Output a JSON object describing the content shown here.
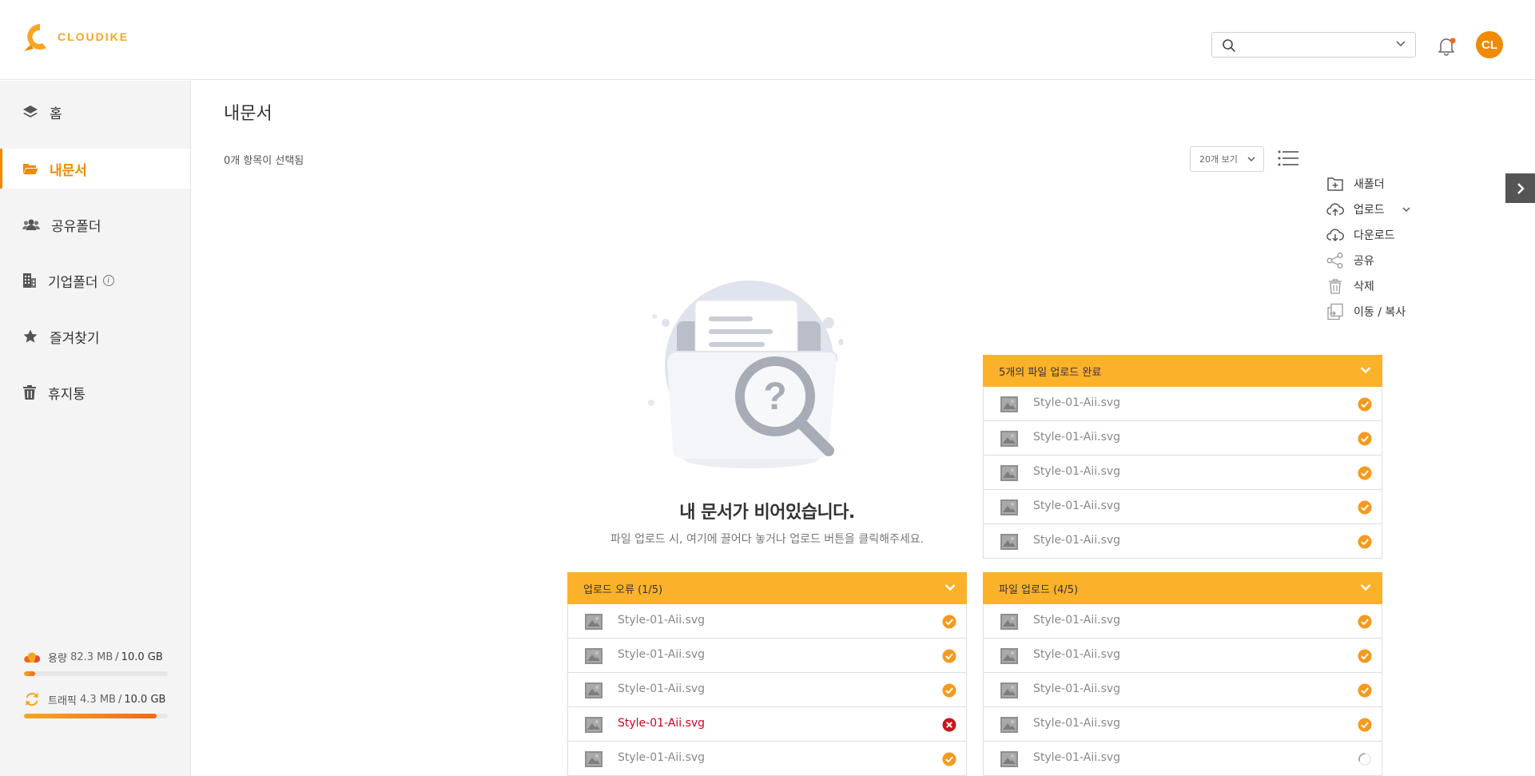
{
  "header": {
    "brand": "CLOUDIKE",
    "avatar_initials": "CL",
    "colors": {
      "brand": "#f5a623",
      "avatar": "#f08a00"
    },
    "icons": [
      "cloudike-logo-icon",
      "search-icon",
      "chevron-down-icon",
      "bell-icon"
    ]
  },
  "sidebar": {
    "items": [
      {
        "label": "홈",
        "icon": "layers-icon",
        "active": false
      },
      {
        "label": "내문서",
        "icon": "folder-open-icon",
        "active": true
      },
      {
        "label": "공유폴더",
        "icon": "users-icon",
        "active": false
      },
      {
        "label": "기업폴더",
        "icon": "building-icon",
        "active": false
      },
      {
        "label": "즐겨찾기",
        "icon": "star-icon",
        "active": false
      },
      {
        "label": "휴지통",
        "icon": "trash-icon",
        "active": false
      }
    ],
    "storage": {
      "label": "용량",
      "used": "82.3 MB",
      "total": "10.0 GB",
      "fill": 0.08
    },
    "traffic": {
      "label": "트래픽",
      "used": "4.3 MB",
      "total": "10.0 GB",
      "fill": 0.92
    }
  },
  "main": {
    "title": "내문서",
    "selected_count": "0개 항목이 선택됨",
    "per_page": "20개 보기",
    "actions": [
      {
        "label": "새폴더",
        "icon": "new-folder-icon"
      },
      {
        "label": "업로드",
        "icon": "cloud-upload-icon",
        "has_dropdown": true
      },
      {
        "label": "다운로드",
        "icon": "cloud-download-icon"
      },
      {
        "label": "공유",
        "icon": "share-icon"
      },
      {
        "label": "삭제",
        "icon": "trash-icon"
      },
      {
        "label": "이동 / 복사",
        "icon": "move-copy-icon"
      }
    ],
    "empty": {
      "title": "내 문서가 비어있습니다.",
      "subtitle": "파일 업로드 시, 여기에 끌어다 놓거나 업로드 버튼을 클릭해주세요."
    }
  },
  "panels": {
    "completed": {
      "title": "5개의 파일 업로드 완료",
      "files": [
        {
          "name": "Style-01-Aii.svg",
          "status": "done"
        },
        {
          "name": "Style-01-Aii.svg",
          "status": "done"
        },
        {
          "name": "Style-01-Aii.svg",
          "status": "done"
        },
        {
          "name": "Style-01-Aii.svg",
          "status": "done"
        },
        {
          "name": "Style-01-Aii.svg",
          "status": "done"
        }
      ]
    },
    "error": {
      "title": "업로드 오류 (1/5)",
      "files": [
        {
          "name": "Style-01-Aii.svg",
          "status": "done"
        },
        {
          "name": "Style-01-Aii.svg",
          "status": "done"
        },
        {
          "name": "Style-01-Aii.svg",
          "status": "done"
        },
        {
          "name": "Style-01-Aii.svg",
          "status": "error"
        },
        {
          "name": "Style-01-Aii.svg",
          "status": "done"
        }
      ]
    },
    "progress": {
      "title": "파일 업로드 (4/5)",
      "files": [
        {
          "name": "Style-01-Aii.svg",
          "status": "done"
        },
        {
          "name": "Style-01-Aii.svg",
          "status": "done"
        },
        {
          "name": "Style-01-Aii.svg",
          "status": "done"
        },
        {
          "name": "Style-01-Aii.svg",
          "status": "done"
        },
        {
          "name": "Style-01-Aii.svg",
          "status": "loading"
        }
      ]
    }
  }
}
